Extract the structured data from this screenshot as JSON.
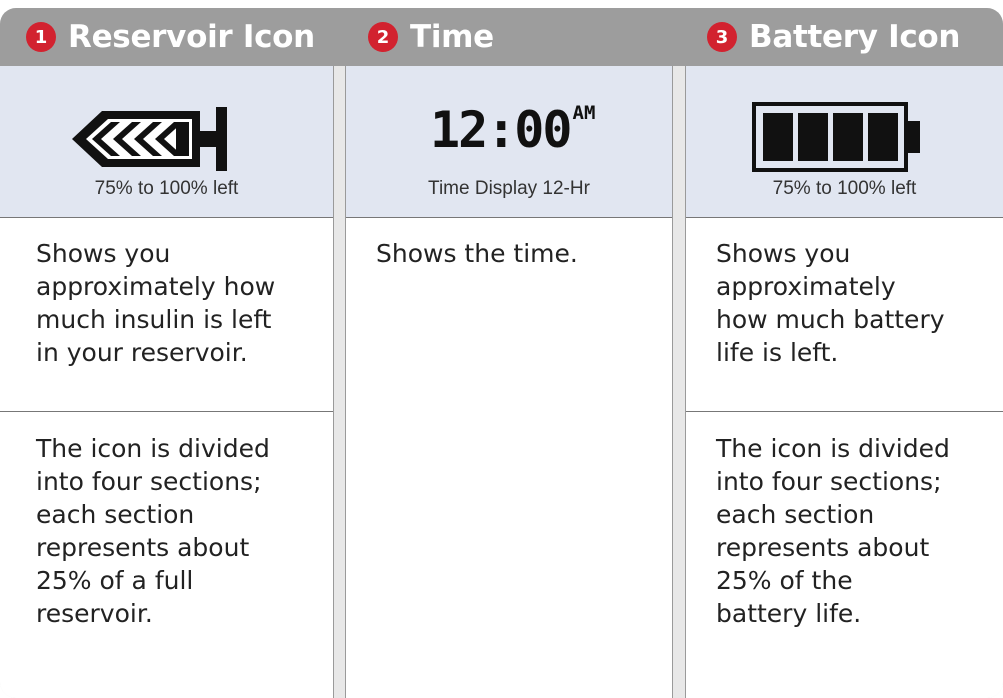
{
  "headers": [
    {
      "number": "1",
      "title": "Reservoir Icon"
    },
    {
      "number": "2",
      "title": "Time"
    },
    {
      "number": "3",
      "title": "Battery Icon"
    }
  ],
  "reservoir": {
    "icon": "reservoir-syringe-icon",
    "caption": "75% to 100% left",
    "level_percent": 100,
    "description": "Shows you\napproximately how\nmuch insulin is left\nin your reservoir.",
    "detail": "The icon is divided\ninto four sections;\neach section\nrepresents about\n25% of a full\nreservoir."
  },
  "time": {
    "display_time": "12:00",
    "display_suffix": "AM",
    "caption": "Time Display 12-Hr",
    "description": "Shows the time."
  },
  "battery": {
    "icon": "battery-icon",
    "caption": "75% to 100% left",
    "level_percent": 100,
    "description": "Shows you\napproximately\nhow much battery\nlife is left.",
    "detail": "The icon is divided\ninto four sections;\neach section\nrepresents about\n25% of the\nbattery life."
  },
  "colors": {
    "badge": "#d2222f",
    "header": "#9d9d9d",
    "icon_row": "#e1e6f1",
    "lcd": "#111111"
  }
}
